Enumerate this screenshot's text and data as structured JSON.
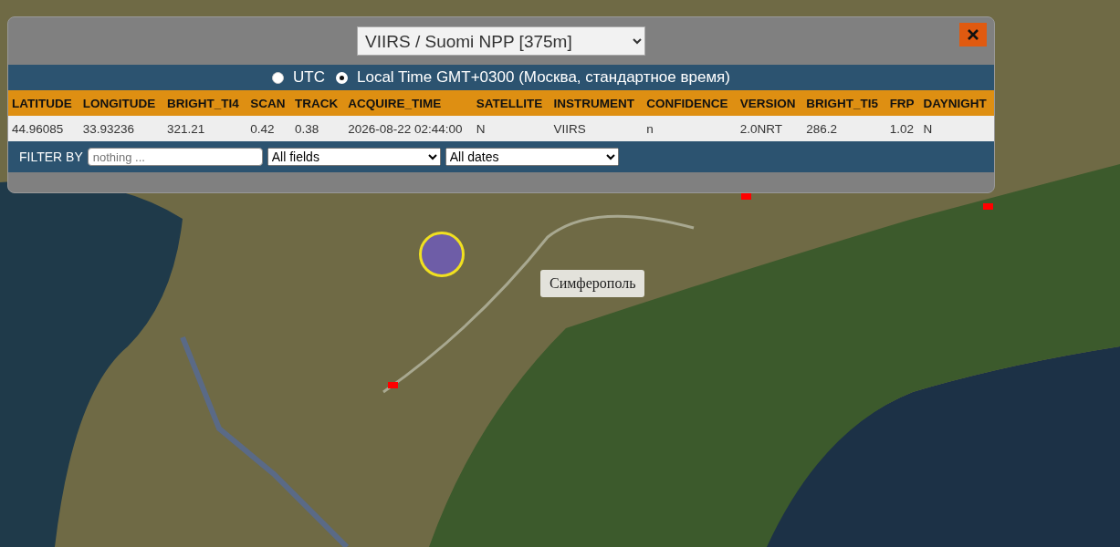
{
  "dataset_select": {
    "value": "VIIRS / Suomi NPP [375m]"
  },
  "time_mode": [
    {
      "label": "UTC",
      "selected": false
    },
    {
      "label": "Local Time GMT+0300 (Москва, стандартное время)",
      "selected": true
    }
  ],
  "table": {
    "columns": [
      "LATITUDE",
      "LONGITUDE",
      "BRIGHT_TI4",
      "SCAN",
      "TRACK",
      "ACQUIRE_TIME",
      "SATELLITE",
      "INSTRUMENT",
      "CONFIDENCE",
      "VERSION",
      "BRIGHT_TI5",
      "FRP",
      "DAYNIGHT"
    ],
    "rows": [
      [
        "44.96085",
        "33.93236",
        "321.21",
        "0.42",
        "0.38",
        "2026-08-22 02:44:00",
        "N",
        "VIIRS",
        "n",
        "2.0NRT",
        "286.2",
        "1.02",
        "N"
      ]
    ]
  },
  "filter": {
    "label": "FILTER BY",
    "placeholder": "nothing ...",
    "field_select": "All fields",
    "date_select": "All dates"
  },
  "map": {
    "city_label": "Симферополь"
  }
}
